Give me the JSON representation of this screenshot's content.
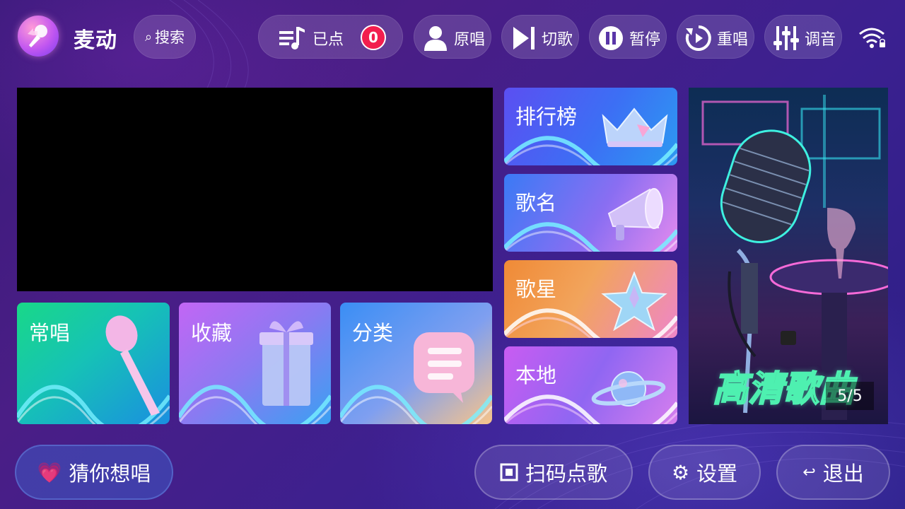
{
  "app": {
    "name": "麦动"
  },
  "topbar": {
    "search_label": "搜索",
    "queued_label": "已点",
    "queued_count": "0",
    "controls": [
      {
        "id": "original",
        "label": "原唱",
        "icon": "singer-icon"
      },
      {
        "id": "next",
        "label": "切歌",
        "icon": "skip-icon"
      },
      {
        "id": "pause",
        "label": "暂停",
        "icon": "pause-icon"
      },
      {
        "id": "replay",
        "label": "重唱",
        "icon": "replay-icon"
      },
      {
        "id": "tune",
        "label": "调音",
        "icon": "equalizer-icon"
      }
    ],
    "wifi_icon": "wifi-icon"
  },
  "tiles": {
    "changchang": "常唱",
    "shoucang": "收藏",
    "fenlei": "分类",
    "rank": "排行榜",
    "song": "歌名",
    "star": "歌星",
    "local": "本地"
  },
  "banner": {
    "title": "高清歌曲",
    "counter": "5/5"
  },
  "bottom": {
    "guess_label": "猜你想唱",
    "scan_label": "扫码点歌",
    "settings_label": "设置",
    "exit_label": "退出"
  },
  "colors": {
    "badge": "#f21e4e",
    "banner_title_stroke": "#4ef0b0"
  }
}
